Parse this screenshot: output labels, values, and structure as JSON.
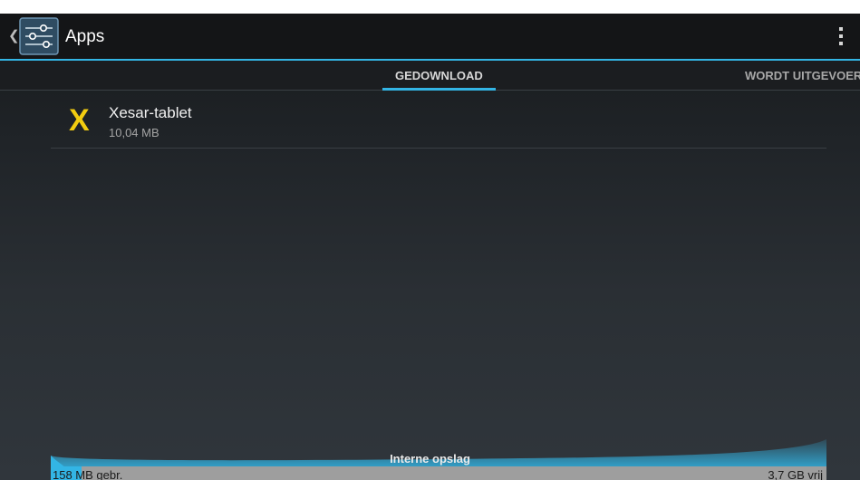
{
  "header": {
    "title": "Apps",
    "icon": "settings-sliders-icon",
    "up_icon": "chevron-left-icon",
    "overflow_icon": "overflow-menu-icon"
  },
  "tabs": [
    {
      "label": "GEDOWNLOAD",
      "active": true
    },
    {
      "label": "WORDT UITGEVOERD",
      "active": false
    }
  ],
  "apps": [
    {
      "name": "Xesar-tablet",
      "size": "10,04 MB",
      "icon": "X",
      "icon_color": "#f2cc10"
    }
  ],
  "storage": {
    "label": "Interne opslag",
    "used": "158 MB gebr.",
    "free": "3,7 GB vrij",
    "used_fraction": 0.04
  },
  "colors": {
    "accent": "#33b5e5",
    "app_icon": "#f2cc10",
    "actionbar_bg": "#141517"
  }
}
